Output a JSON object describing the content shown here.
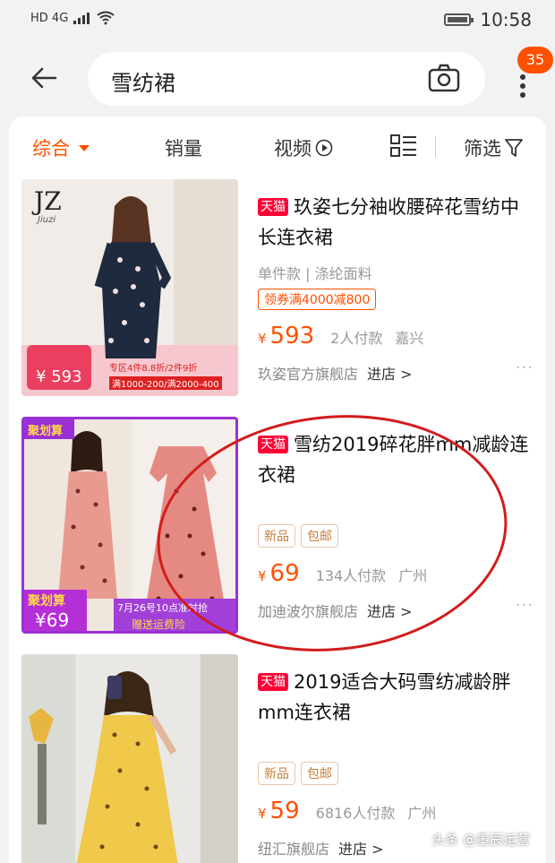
{
  "status": {
    "left": "HD 4G",
    "time": "10:58"
  },
  "search": {
    "query": "雪纺裙",
    "badge": "35"
  },
  "filters": {
    "comprehensive": "综合",
    "sales": "销量",
    "video": "视频",
    "filter": "筛选"
  },
  "products": [
    {
      "badge": "天猫",
      "title": "玖姿七分袖收腰碎花雪纺中长连衣裙",
      "attrs": "单件款 | 涤纶面料",
      "coupon": "领券满4000减800",
      "yen": "¥",
      "price": "593",
      "sales": "2人付款",
      "location": "嘉兴",
      "store": "玖姿官方旗舰店",
      "enter": "进店 >",
      "image_text": {
        "logo": "JZ",
        "logo_sub": "Jiuzi",
        "promo_price": "593",
        "promo_line1": "专区4件8.8折/2件9折",
        "promo_line2": "满1000-200/满2000-400"
      }
    },
    {
      "badge": "天猫",
      "title": "雪纺2019碎花胖mm减龄连衣裙",
      "tags": [
        "新品",
        "包邮"
      ],
      "yen": "¥",
      "price": "69",
      "sales": "134人付款",
      "location": "广州",
      "store": "加迪波尔旗舰店",
      "enter": "进店 >",
      "image_text": {
        "brand": "聚划算",
        "promo_price": "69",
        "promo_date": "7月26号10点准时抢",
        "promo_gift": "赠送运费险"
      }
    },
    {
      "badge": "天猫",
      "title": "2019适合大码雪纺减龄胖mm连衣裙",
      "tags": [
        "新品",
        "包邮"
      ],
      "yen": "¥",
      "price": "59",
      "sales": "6816人付款",
      "location": "广州",
      "store": "纽汇旗舰店",
      "enter": "进店 >"
    }
  ],
  "more_dots": "···",
  "watermark": "头条 @墨辰运营",
  "colors": {
    "accent": "#ff5000",
    "tmall": "#ff0036",
    "circle": "#d21c1c"
  }
}
